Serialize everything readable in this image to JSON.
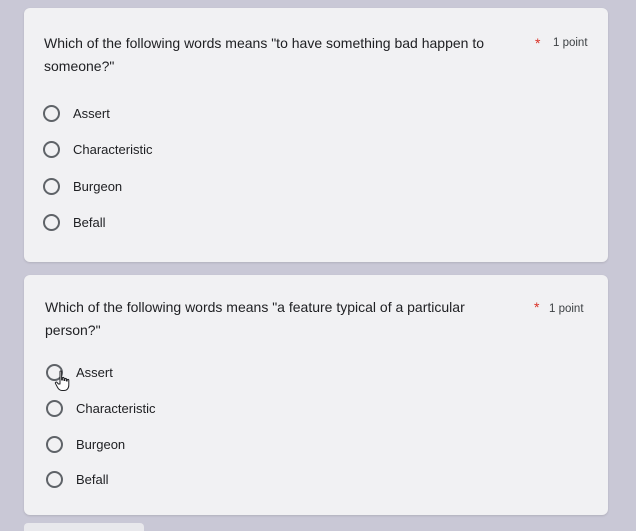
{
  "questions": [
    {
      "title": "Which of the following words means \"to have something bad happen to someone?\"",
      "required_mark": "*",
      "points": "1 point",
      "options": [
        "Assert",
        "Characteristic",
        "Burgeon",
        "Befall"
      ]
    },
    {
      "title": "Which of the following words means \"a feature typical of a particular person?\"",
      "required_mark": "*",
      "points": "1 point",
      "options": [
        "Assert",
        "Characteristic",
        "Burgeon",
        "Befall"
      ]
    }
  ],
  "colors": {
    "background": "#c9c8d6",
    "card": "#f1f1f3",
    "required": "#d93025",
    "radio_border": "#5f6368"
  },
  "icons": [
    "radio-unselected-icon",
    "hand-pointer-cursor-icon"
  ]
}
